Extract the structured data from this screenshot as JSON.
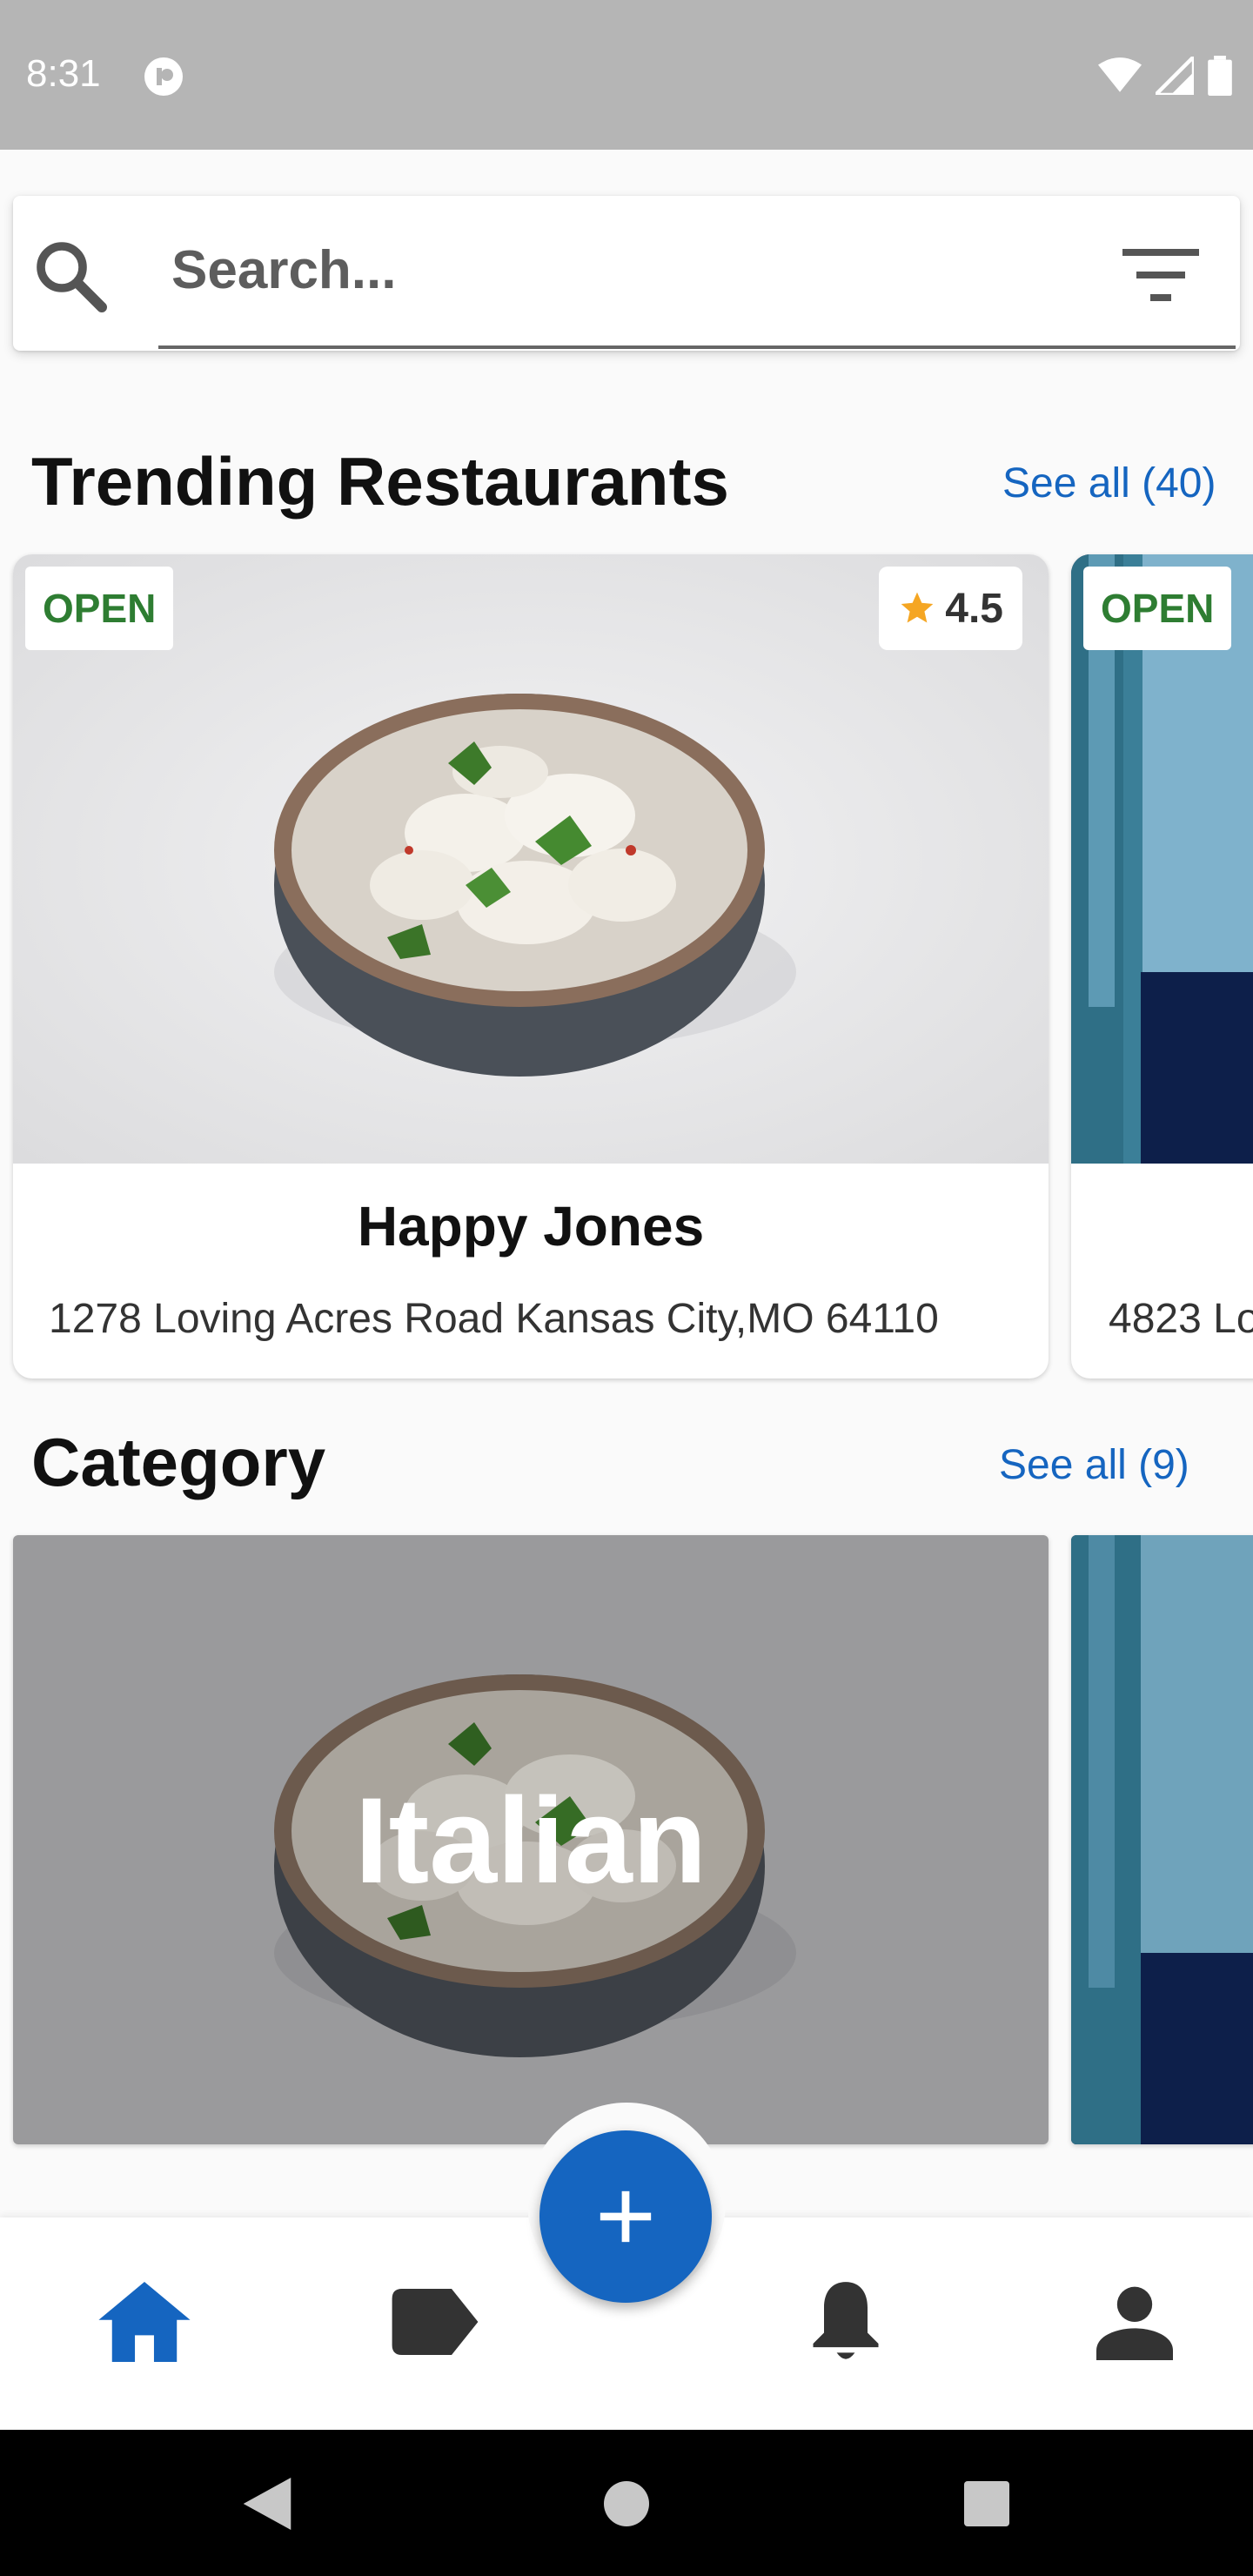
{
  "status_bar": {
    "time": "8:31"
  },
  "search": {
    "placeholder": "Search..."
  },
  "trending": {
    "title": "Trending Restaurants",
    "see_all": "See all (40)",
    "restaurants": [
      {
        "status": "OPEN",
        "rating": "4.5",
        "name": "Happy Jones",
        "address": "1278 Loving Acres Road Kansas City,MO 64110"
      },
      {
        "status": "OPEN",
        "address": "4823 Lo"
      }
    ]
  },
  "category": {
    "title": "Category",
    "see_all": "See all (9)",
    "items": [
      {
        "label": "Italian"
      }
    ]
  },
  "bottom_nav": {
    "items": [
      "home-icon",
      "tag-icon",
      "bell-icon",
      "person-icon"
    ],
    "active": "home-icon",
    "fab_icon": "plus-icon"
  },
  "colors": {
    "accent": "#1565c0",
    "open_badge": "#2e7d32",
    "star": "#f5a623"
  }
}
